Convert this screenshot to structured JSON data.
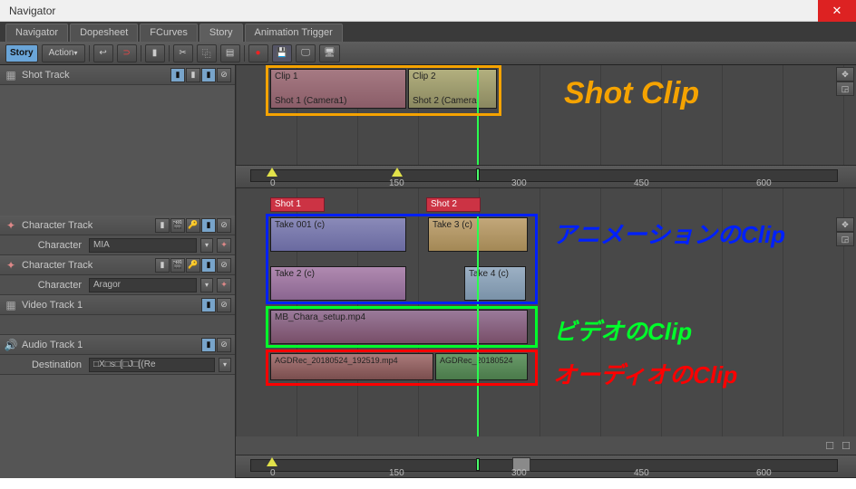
{
  "window": {
    "title": "Navigator"
  },
  "tabs": [
    "Navigator",
    "Dopesheet",
    "FCurves",
    "Story",
    "Animation Trigger"
  ],
  "activeTab": "Story",
  "toolbar": {
    "story": "Story",
    "action": "Action"
  },
  "ruler": {
    "marks": [
      "0",
      "150",
      "300",
      "450",
      "600"
    ]
  },
  "annotations": {
    "shotClip": "Shot Clip",
    "animClip": "アニメーションのClip",
    "videoClip": "ビデオのClip",
    "audioClip": "オーディオのClip"
  },
  "shotTrack": {
    "label": "Shot Track",
    "clips": [
      {
        "name": "Clip 1",
        "sub": "Shot 1 (Camera1)"
      },
      {
        "name": "Clip 2",
        "sub": "Shot 2 (Camera"
      }
    ]
  },
  "shotTabs": [
    "Shot 1",
    "Shot 2"
  ],
  "charTracks": [
    {
      "label": "Character Track",
      "charLabel": "Character",
      "charName": "MIA",
      "clips": [
        {
          "name": "Take 001 (c)"
        },
        {
          "name": "Take 3 (c)"
        }
      ]
    },
    {
      "label": "Character Track",
      "charLabel": "Character",
      "charName": "Aragor",
      "clips": [
        {
          "name": "Take 2 (c)"
        },
        {
          "name": "Take 4 (c)"
        }
      ]
    }
  ],
  "videoTrack": {
    "label": "Video Track 1",
    "clip": {
      "name": "MB_Chara_setup.mp4"
    }
  },
  "audioTrack": {
    "label": "Audio Track 1",
    "destLabel": "Destination",
    "destVal": "□X□s□[□J□[(Re",
    "clips": [
      {
        "name": "AGDRec_20180524_192519.mp4"
      },
      {
        "name": "AGDRec_20180524"
      }
    ]
  },
  "chart_data": {
    "type": "table",
    "title": "Story timeline layout",
    "frame_range": [
      0,
      700
    ],
    "tracks": [
      {
        "track": "Shot Track",
        "clips": [
          {
            "name": "Clip 1",
            "camera": "Shot 1 (Camera1)",
            "start": 0,
            "end": 150
          },
          {
            "name": "Clip 2",
            "camera": "Shot 2 (Camera)",
            "start": 150,
            "end": 260
          }
        ]
      },
      {
        "track": "Character Track — MIA",
        "clips": [
          {
            "name": "Take 001 (c)",
            "start": 0,
            "end": 150
          },
          {
            "name": "Take 3 (c)",
            "start": 180,
            "end": 300
          }
        ]
      },
      {
        "track": "Character Track — Aragor",
        "clips": [
          {
            "name": "Take 2 (c)",
            "start": 0,
            "end": 150
          },
          {
            "name": "Take 4 (c)",
            "start": 220,
            "end": 290
          }
        ]
      },
      {
        "track": "Video Track 1",
        "clips": [
          {
            "name": "MB_Chara_setup.mp4",
            "start": 0,
            "end": 300
          }
        ]
      },
      {
        "track": "Audio Track 1",
        "clips": [
          {
            "name": "AGDRec_20180524_192519.mp4",
            "start": 0,
            "end": 185
          },
          {
            "name": "AGDRec_20180524",
            "start": 185,
            "end": 300
          }
        ]
      }
    ]
  }
}
